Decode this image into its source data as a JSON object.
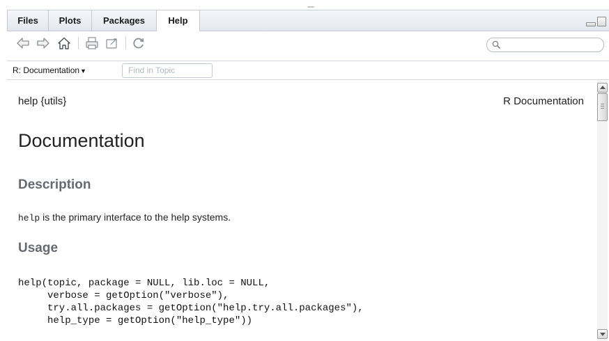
{
  "tabs": [
    {
      "label": "Files",
      "active": false
    },
    {
      "label": "Plots",
      "active": false
    },
    {
      "label": "Packages",
      "active": false
    },
    {
      "label": "Help",
      "active": true
    }
  ],
  "toolbar": {
    "icons": [
      "back-arrow-icon",
      "forward-arrow-icon",
      "home-icon",
      "print-icon",
      "open-in-new-window-icon",
      "refresh-icon"
    ],
    "search_placeholder": "",
    "search_value": ""
  },
  "pathbar": {
    "topic_label": "R: Documentation",
    "caret": "▼",
    "find_placeholder": "Find in Topic"
  },
  "doc": {
    "header_left": "help {utils}",
    "header_right": "R Documentation",
    "title": "Documentation",
    "description_heading": "Description",
    "description_code": "help",
    "description_text": " is the primary interface to the help systems.",
    "usage_heading": "Usage",
    "usage_code": "help(topic, package = NULL, lib.loc = NULL,\n     verbose = getOption(\"verbose\"),\n     try.all.packages = getOption(\"help.try.all.packages\"),\n     help_type = getOption(\"help_type\"))"
  },
  "colors": {
    "heading_gray": "#666a70",
    "tab_bar_bg": "#e4e8ee",
    "accent_green": "#3a8a3a"
  }
}
